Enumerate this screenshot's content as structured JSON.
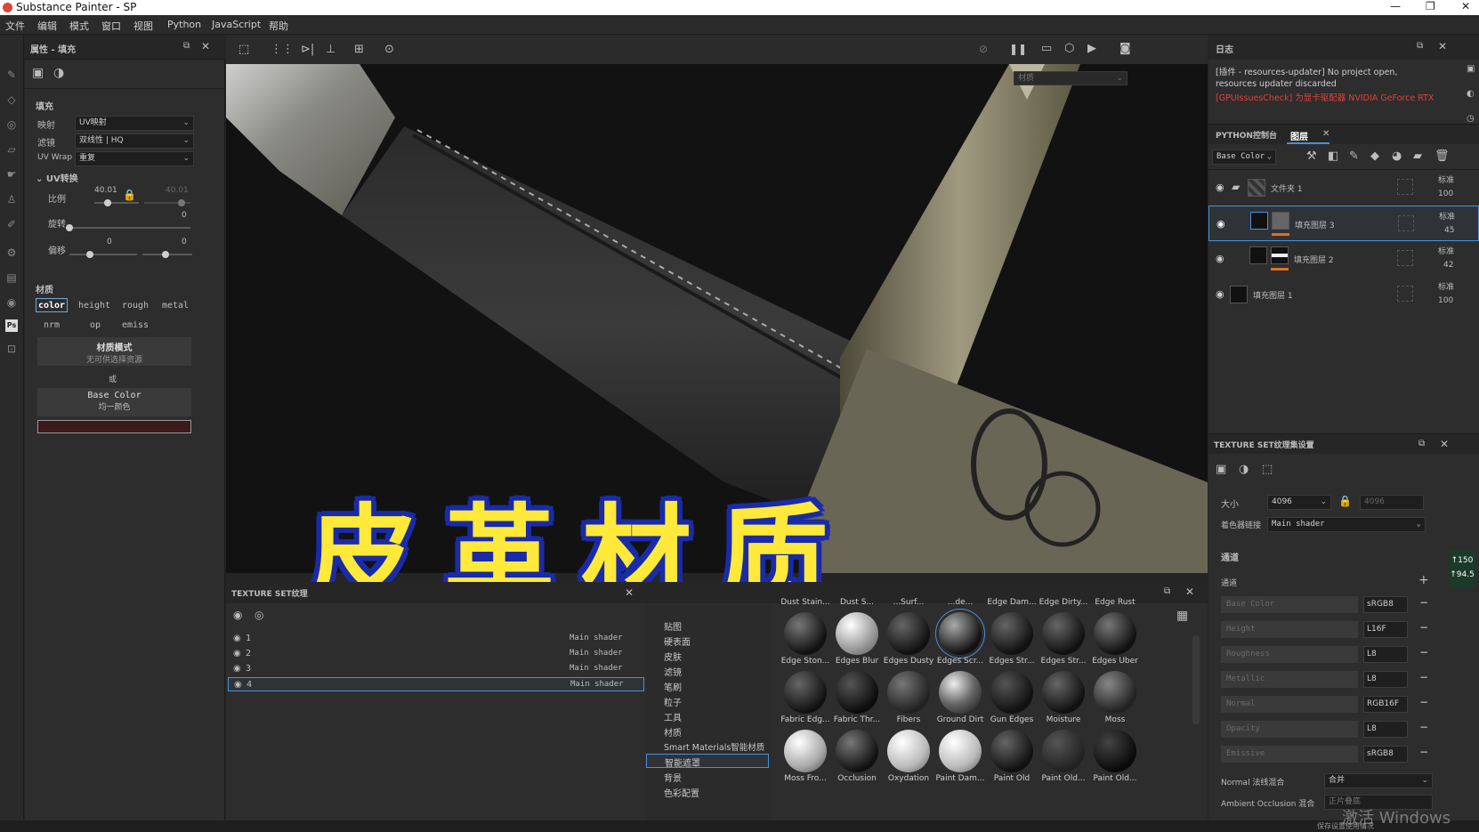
{
  "window": {
    "title": "Substance Painter - SP"
  },
  "menu": [
    "文件",
    "编辑",
    "模式",
    "窗口",
    "视图",
    "Python",
    "JavaScript",
    "帮助"
  ],
  "properties": {
    "header": "属性 - 填充",
    "section_fill": "填充",
    "mapping_label": "映射",
    "mapping_value": "UV映射",
    "filter_label": "滤镜",
    "filter_value": "双线性 | HQ",
    "uvwrap_label": "UV Wrap",
    "uvwrap_value": "重复",
    "uv_transform": "UV转换",
    "scale_label": "比例",
    "scale_value": "40.01",
    "scale_value_locked": "40.01",
    "rotate_label": "旋转",
    "rotate_value": "0",
    "offset_label": "偏移",
    "offset_x": "0",
    "offset_y": "0",
    "material_title": "材质",
    "channels_row1": [
      "color",
      "height",
      "rough",
      "metal"
    ],
    "channels_row2": [
      "nrm",
      "op",
      "emiss"
    ],
    "material_mode": "材质模式",
    "material_mode_sub": "无可供选择资源",
    "or": "或",
    "base_color": "Base Color",
    "base_color_sub": "均一颜色",
    "swatch_color": "#3a1a1a"
  },
  "log": {
    "title": "日志",
    "line1": "[插件 - resources-updater] No project open, resources updater discarded",
    "line2": "[GPUIssuesCheck] 为显卡驱配器 NVIDIA GeForce RTX"
  },
  "layers": {
    "tab_python": "PYTHON控制台",
    "tab_layers": "图层",
    "channel_select": "Base Color",
    "items": [
      {
        "name": "文件夹 1",
        "blend": "标准",
        "opacity": "100"
      },
      {
        "name": "填充图层 3",
        "blend": "标准",
        "opacity": "45"
      },
      {
        "name": "填充图层 2",
        "blend": "标准",
        "opacity": "42"
      },
      {
        "name": "填充图层 1",
        "blend": "标准",
        "opacity": "100"
      }
    ]
  },
  "texture_set_settings": {
    "title": "TEXTURE SET纹理集设置",
    "size_label": "大小",
    "size_value": "4096",
    "size_value2": "4096",
    "shader_label": "着色器链接",
    "shader_value": "Main shader",
    "channels_title": "通道",
    "channels_sub": "通道",
    "channels": [
      {
        "name": "Base Color",
        "format": "sRGB8"
      },
      {
        "name": "Height",
        "format": "L16F"
      },
      {
        "name": "Roughness",
        "format": "L8"
      },
      {
        "name": "Metallic",
        "format": "L8"
      },
      {
        "name": "Normal",
        "format": "RGB16F"
      },
      {
        "name": "Opacity",
        "format": "L8"
      },
      {
        "name": "Emissive",
        "format": "sRGB8"
      }
    ],
    "normal_mix_label": "Normal 法线混合",
    "normal_mix_value": "合并",
    "ao_mix_label": "Ambient Occlusion 混合",
    "ao_mix_value": "正片叠底"
  },
  "texture_list": {
    "title": "TEXTURE SET纹理",
    "rows": [
      {
        "num": "1",
        "shader": "Main shader"
      },
      {
        "num": "2",
        "shader": "Main shader"
      },
      {
        "num": "3",
        "shader": "Main shader"
      },
      {
        "num": "4",
        "shader": "Main shader"
      }
    ]
  },
  "shelf": {
    "categories": [
      "贴图",
      "硬表面",
      "皮肤",
      "滤镜",
      "笔刷",
      "粒子",
      "工具",
      "材质",
      "Smart Materials智能材质",
      "智能遮罩",
      "背景",
      "色彩配置"
    ],
    "selected_category": "智能遮罩",
    "top_labels": [
      "Dust Stain...",
      "Dust S...",
      "...Surf...",
      "...de...",
      "Edge Dam...",
      "Edge Dirty...",
      "Edge Rust"
    ],
    "row1": [
      "Edge Ston...",
      "Edges Blur",
      "Edges Dusty",
      "Edges Scr...",
      "Edges Str...",
      "Edges Str...",
      "Edges Uber"
    ],
    "row2": [
      "Fabric Edg...",
      "Fabric Thr...",
      "Fibers",
      "Ground Dirt",
      "Gun Edges",
      "Moisture",
      "Moss"
    ],
    "row3": [
      "Moss Fro...",
      "Occlusion",
      "Oxydation",
      "Paint Dam...",
      "Paint Old",
      "Paint Old...",
      "Paint Old..."
    ]
  },
  "viewport": {
    "overlay_title": "皮革材质",
    "material_dropdown": "材质"
  },
  "fps": {
    "top": "150",
    "bottom": "94.5"
  },
  "watermark": "激活 Windows",
  "status": "保存设置使用情况"
}
